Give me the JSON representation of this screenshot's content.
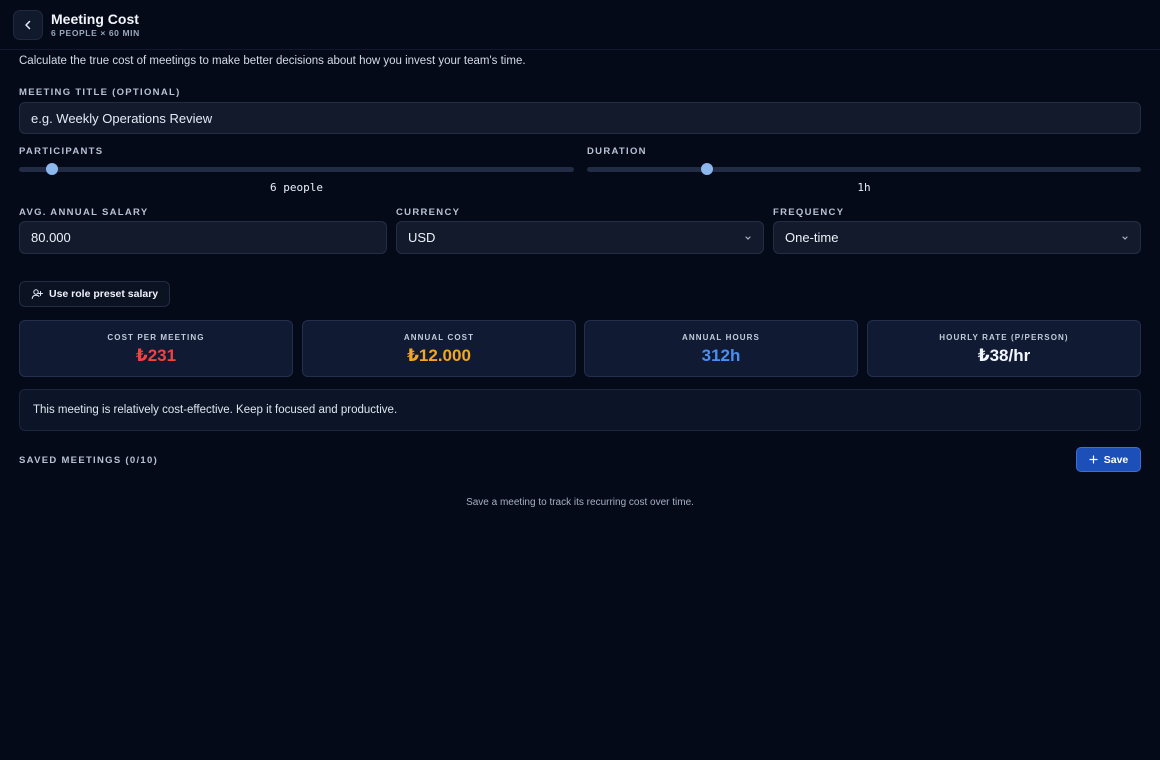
{
  "header": {
    "title": "Meeting Cost",
    "subtitle": "6 PEOPLE × 60 MIN"
  },
  "intro": "Calculate the true cost of meetings to make better decisions about how you invest your team's time.",
  "meeting_title": {
    "label": "MEETING TITLE (OPTIONAL)",
    "placeholder": "e.g. Weekly Operations Review",
    "value": ""
  },
  "participants": {
    "label": "PARTICIPANTS",
    "value_text": "6 people",
    "level": 0.05
  },
  "duration": {
    "label": "DURATION",
    "value_text": "1h",
    "level": 0.21
  },
  "salary": {
    "label": "AVG. ANNUAL SALARY",
    "value": "80.000"
  },
  "currency": {
    "label": "CURRENCY",
    "selected": "USD"
  },
  "frequency": {
    "label": "FREQUENCY",
    "selected": "One-time"
  },
  "preset_button": {
    "label": "Use role preset salary",
    "icon": "user-plus-icon"
  },
  "stats": [
    {
      "label": "COST PER MEETING",
      "value": "₺231",
      "color": "#f0433f"
    },
    {
      "label": "ANNUAL COST",
      "value": "₺12.000",
      "color": "#f5a524"
    },
    {
      "label": "ANNUAL HOURS",
      "value": "312h",
      "color": "#4b8ef2"
    },
    {
      "label": "HOURLY RATE (P/PERSON)",
      "value": "₺38/hr",
      "color": "#f2f5fb"
    }
  ],
  "note": "This meeting is relatively cost-effective. Keep it focused and productive.",
  "saved": {
    "label": "SAVED MEETINGS (0/10)",
    "save_label": "Save",
    "empty_text": "Save a meeting to track its recurring cost over time."
  },
  "colors": {
    "background": "#050a18",
    "accent": "#1c4fb8",
    "slider_thumb": "#8db8ee"
  }
}
